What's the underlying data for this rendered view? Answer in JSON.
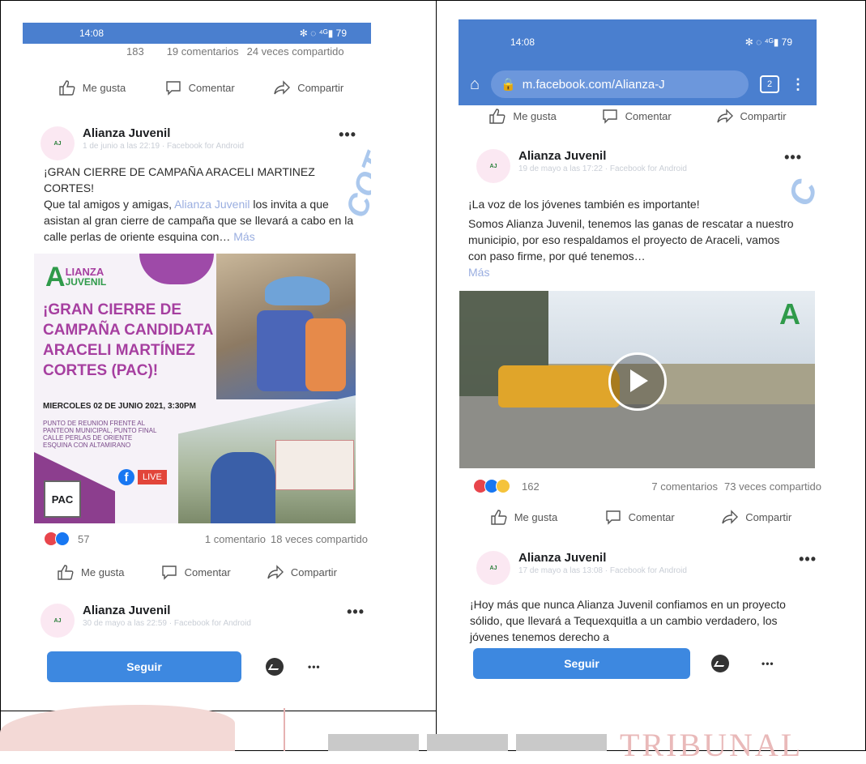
{
  "left": {
    "status": {
      "time": "14:08",
      "icons_right": "✻ ◌ ⁴ᴳ▮ 79"
    },
    "top_reactions": {
      "count": "183",
      "comments": "19 comentarios",
      "shares": "24 veces compartido"
    },
    "actions": {
      "like": "Me gusta",
      "comment": "Comentar",
      "share": "Compartir"
    },
    "post1": {
      "page_name": "Alianza Juvenil",
      "meta": "1 de junio a las 22:19 · Facebook for Android",
      "line1": "¡GRAN CIERRE DE CAMPAÑA ARACELI MARTINEZ CORTES!",
      "line2": "Que tal amigos y amigas,",
      "mention": "Alianza Juvenil",
      "line3": "los invita a que asistan al gran cierre de campaña que se llevará a cabo en la calle perlas de oriente esquina con…",
      "more": "Más"
    },
    "poster": {
      "logo_top": "LIANZA",
      "logo_bottom": "JUVENIL",
      "title": "¡GRAN CIERRE DE CAMPAÑA CANDIDATA ARACELI MARTÍNEZ CORTES (PAC)!",
      "date": "MIERCOLES 02 DE JUNIO 2021, 3:30PM",
      "place": "PUNTO DE REUNION FRENTE AL PANTEON MUNICIPAL, PUNTO FINAL CALLE PERLAS DE ORIENTE ESQUINA CON ALTAMIRANO",
      "live": "LIVE",
      "party": "PAC"
    },
    "post1_stats": {
      "count": "57",
      "comments": "1 comentario",
      "shares": "18 veces compartido"
    },
    "post2": {
      "page_name": "Alianza Juvenil",
      "meta": "30 de mayo a las 22:59 · Facebook for Android"
    },
    "follow": "Seguir",
    "stamp": "COT"
  },
  "right": {
    "status": {
      "time": "14:08",
      "icons_right": "✻ ◌ ⁴ᴳ▮ 79"
    },
    "url": "m.facebook.com/Alianza-J",
    "tabs": "2",
    "actions": {
      "like": "Me gusta",
      "comment": "Comentar",
      "share": "Compartir"
    },
    "post1": {
      "page_name": "Alianza Juvenil",
      "meta": "19 de mayo a las 17:22 · Facebook for Android",
      "line1": "¡La voz de los jóvenes también es importante!",
      "line2": "Somos Alianza Juvenil, tenemos las ganas de rescatar a nuestro municipio, por eso respaldamos el proyecto de Araceli, vamos con paso firme, por qué tenemos…",
      "more": "Más"
    },
    "post1_stats": {
      "count": "162",
      "comments": "7 comentarios",
      "shares": "73 veces compartido"
    },
    "post2": {
      "page_name": "Alianza Juvenil",
      "meta": "17 de mayo a las 13:08 · Facebook for Android",
      "text": "¡Hoy más que nunca Alianza Juvenil confiamos en un proyecto sólido, que llevará a Tequexquitla a un cambio verdadero, los jóvenes tenemos derecho a"
    },
    "follow": "Seguir"
  },
  "footer": {
    "watermark": "TRIBUNAL"
  },
  "colors": {
    "fb_blue": "#3d88e0",
    "status_blue": "#4a7fcf",
    "poster_purple": "#a63fa0"
  }
}
